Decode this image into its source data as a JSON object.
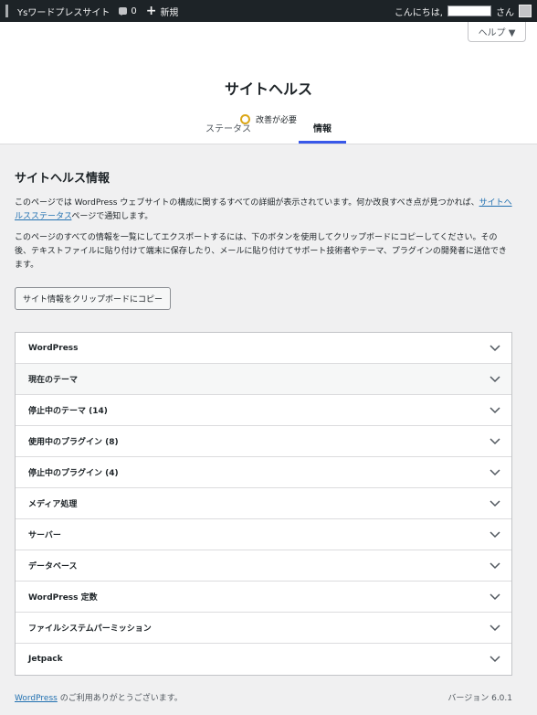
{
  "admin_bar": {
    "site_name": "Ysワードプレスサイト",
    "comments_count": "0",
    "new_label": "新規",
    "greeting": "こんにちは,",
    "greeting_suffix": "さん"
  },
  "header": {
    "help_label": "ヘルプ ▼",
    "title": "サイトヘルス",
    "status_text": "改善が必要",
    "tabs": [
      {
        "label": "ステータス"
      },
      {
        "label": "情報"
      }
    ]
  },
  "main": {
    "section_title": "サイトヘルス情報",
    "para1_text": "このページでは WordPress ウェブサイトの構成に関するすべての詳細が表示されています。何か改良すべき点が見つかれば、",
    "para1_link": "サイトヘルスステータス",
    "para1_suffix": "ページで通知します。",
    "para2_text": "このページのすべての情報を一覧にしてエクスポートするには、下のボタンを使用してクリップボードにコピーしてください。その後、テキストファイルに貼り付けて端末に保存したり、メールに貼り付けてサポート技術者やテーマ、プラグインの開発者に送信できます。",
    "copy_button": "サイト情報をクリップボードにコピー",
    "accordion": [
      {
        "label": "WordPress"
      },
      {
        "label": "現在のテーマ"
      },
      {
        "label": "停止中のテーマ (14)"
      },
      {
        "label": "使用中のプラグイン (8)"
      },
      {
        "label": "停止中のプラグイン (4)"
      },
      {
        "label": "メディア処理"
      },
      {
        "label": "サーバー"
      },
      {
        "label": "データベース"
      },
      {
        "label": "WordPress 定数"
      },
      {
        "label": "ファイルシステムパーミッション"
      },
      {
        "label": "Jetpack"
      }
    ]
  },
  "footer": {
    "wp_link": "WordPress",
    "thanks": " のご利用ありがとうございます。",
    "version": "バージョン 6.0.1"
  },
  "colors": {
    "admin_bar": "#1d2327",
    "tab_accent": "#3858e9",
    "status_warning": "#dba617",
    "link": "#2271b1"
  }
}
